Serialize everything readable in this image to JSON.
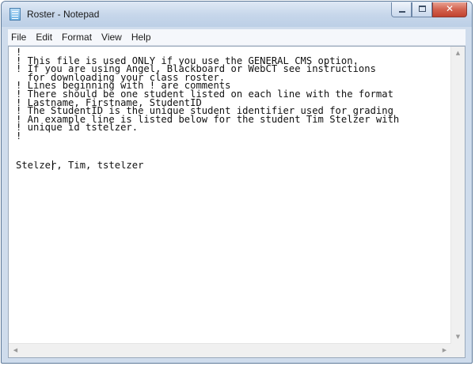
{
  "window": {
    "title": "Roster - Notepad"
  },
  "menu": [
    "File",
    "Edit",
    "Format",
    "View",
    "Help"
  ],
  "document": {
    "comment_lines": [
      "!",
      "! This file is used ONLY if you use the GENERAL CMS option.",
      "! If you are using Angel, Blackboard or WebCT see instructions",
      "  for downloading your class roster.",
      "! Lines beginning with ! are comments",
      "! There should be one student listed on each line with the format",
      "! Lastname, Firstname, StudentID",
      "! The StudentID is the unique student identifier used for grading",
      "! An example line is listed below for the student Tim Stelzer with",
      "! unique id tstelzer.",
      "!"
    ],
    "entry_line": "Stelzer, Tim, tstelzer"
  },
  "icons": {
    "app": "notepad-icon",
    "minimize": "minimize-icon",
    "maximize": "maximize-icon",
    "close": "close-icon",
    "scroll_up": "arrow-up-icon",
    "scroll_down": "arrow-down-icon",
    "scroll_left": "arrow-left-icon",
    "scroll_right": "arrow-right-icon"
  },
  "colors": {
    "close_button": "#c1432f",
    "titlebar": "#c6d6ea"
  }
}
